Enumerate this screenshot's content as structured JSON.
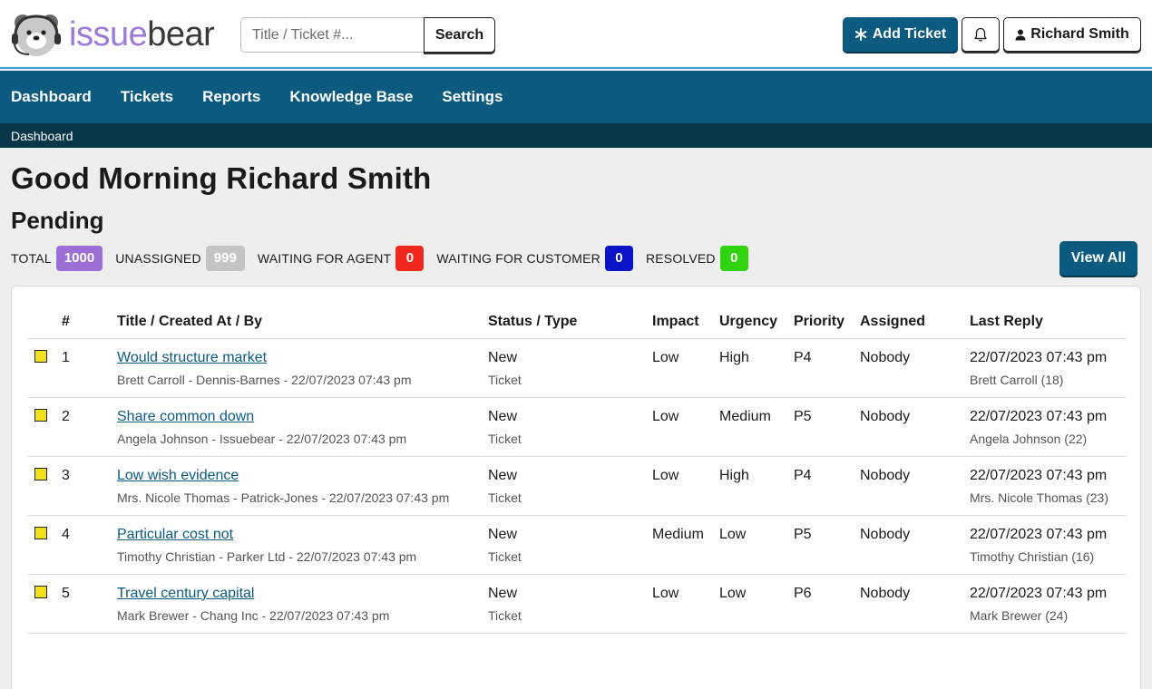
{
  "brand": {
    "part1": "issue",
    "part2": "bear"
  },
  "search": {
    "placeholder": "Title / Ticket #...",
    "button": "Search"
  },
  "header": {
    "add_ticket": "Add Ticket",
    "user": "Richard Smith"
  },
  "nav": {
    "items": [
      "Dashboard",
      "Tickets",
      "Reports",
      "Knowledge Base",
      "Settings"
    ]
  },
  "breadcrumb": "Dashboard",
  "greeting": "Good Morning Richard Smith",
  "section": "Pending",
  "stats": [
    {
      "label": "TOTAL",
      "value": "1000",
      "color": "#9b6fd6"
    },
    {
      "label": "UNASSIGNED",
      "value": "999",
      "color": "#c4c4c4"
    },
    {
      "label": "WAITING FOR AGENT",
      "value": "0",
      "color": "#f0281e"
    },
    {
      "label": "WAITING FOR CUSTOMER",
      "value": "0",
      "color": "#0a14c8"
    },
    {
      "label": "RESOLVED",
      "value": "0",
      "color": "#2fd40f"
    }
  ],
  "view_all": "View All",
  "table": {
    "headers": [
      "#",
      "Title / Created At / By",
      "Status / Type",
      "Impact",
      "Urgency",
      "Priority",
      "Assigned",
      "Last Reply"
    ],
    "rows": [
      {
        "num": "1",
        "title": "Would structure market",
        "meta": "Brett Carroll - Dennis-Barnes - 22/07/2023 07:43 pm",
        "status": "New",
        "type": "Ticket",
        "impact": "Low",
        "urgency": "High",
        "priority": "P4",
        "assigned": "Nobody",
        "reply_date": "22/07/2023 07:43 pm",
        "reply_by": "Brett Carroll (18)"
      },
      {
        "num": "2",
        "title": "Share common down",
        "meta": "Angela Johnson - Issuebear - 22/07/2023 07:43 pm",
        "status": "New",
        "type": "Ticket",
        "impact": "Low",
        "urgency": "Medium",
        "priority": "P5",
        "assigned": "Nobody",
        "reply_date": "22/07/2023 07:43 pm",
        "reply_by": "Angela Johnson (22)"
      },
      {
        "num": "3",
        "title": "Low wish evidence",
        "meta": "Mrs. Nicole Thomas - Patrick-Jones - 22/07/2023 07:43 pm",
        "status": "New",
        "type": "Ticket",
        "impact": "Low",
        "urgency": "High",
        "priority": "P4",
        "assigned": "Nobody",
        "reply_date": "22/07/2023 07:43 pm",
        "reply_by": "Mrs. Nicole Thomas (23)"
      },
      {
        "num": "4",
        "title": "Particular cost not",
        "meta": "Timothy Christian - Parker Ltd - 22/07/2023 07:43 pm",
        "status": "New",
        "type": "Ticket",
        "impact": "Medium",
        "urgency": "Low",
        "priority": "P5",
        "assigned": "Nobody",
        "reply_date": "22/07/2023 07:43 pm",
        "reply_by": "Timothy Christian (16)"
      },
      {
        "num": "5",
        "title": "Travel century capital",
        "meta": "Mark Brewer - Chang Inc - 22/07/2023 07:43 pm",
        "status": "New",
        "type": "Ticket",
        "impact": "Low",
        "urgency": "Low",
        "priority": "P6",
        "assigned": "Nobody",
        "reply_date": "22/07/2023 07:43 pm",
        "reply_by": "Mark Brewer (24)"
      }
    ]
  },
  "colors": {
    "primary": "#0b5a7f",
    "breadcrumb_bg": "#053649",
    "priority_marker": "#f0e11a",
    "page_bg": "#eeeeee"
  },
  "icons": {
    "logo": "bear-headset-icon",
    "add": "asterisk-icon",
    "bell": "bell-icon",
    "user": "person-icon"
  }
}
